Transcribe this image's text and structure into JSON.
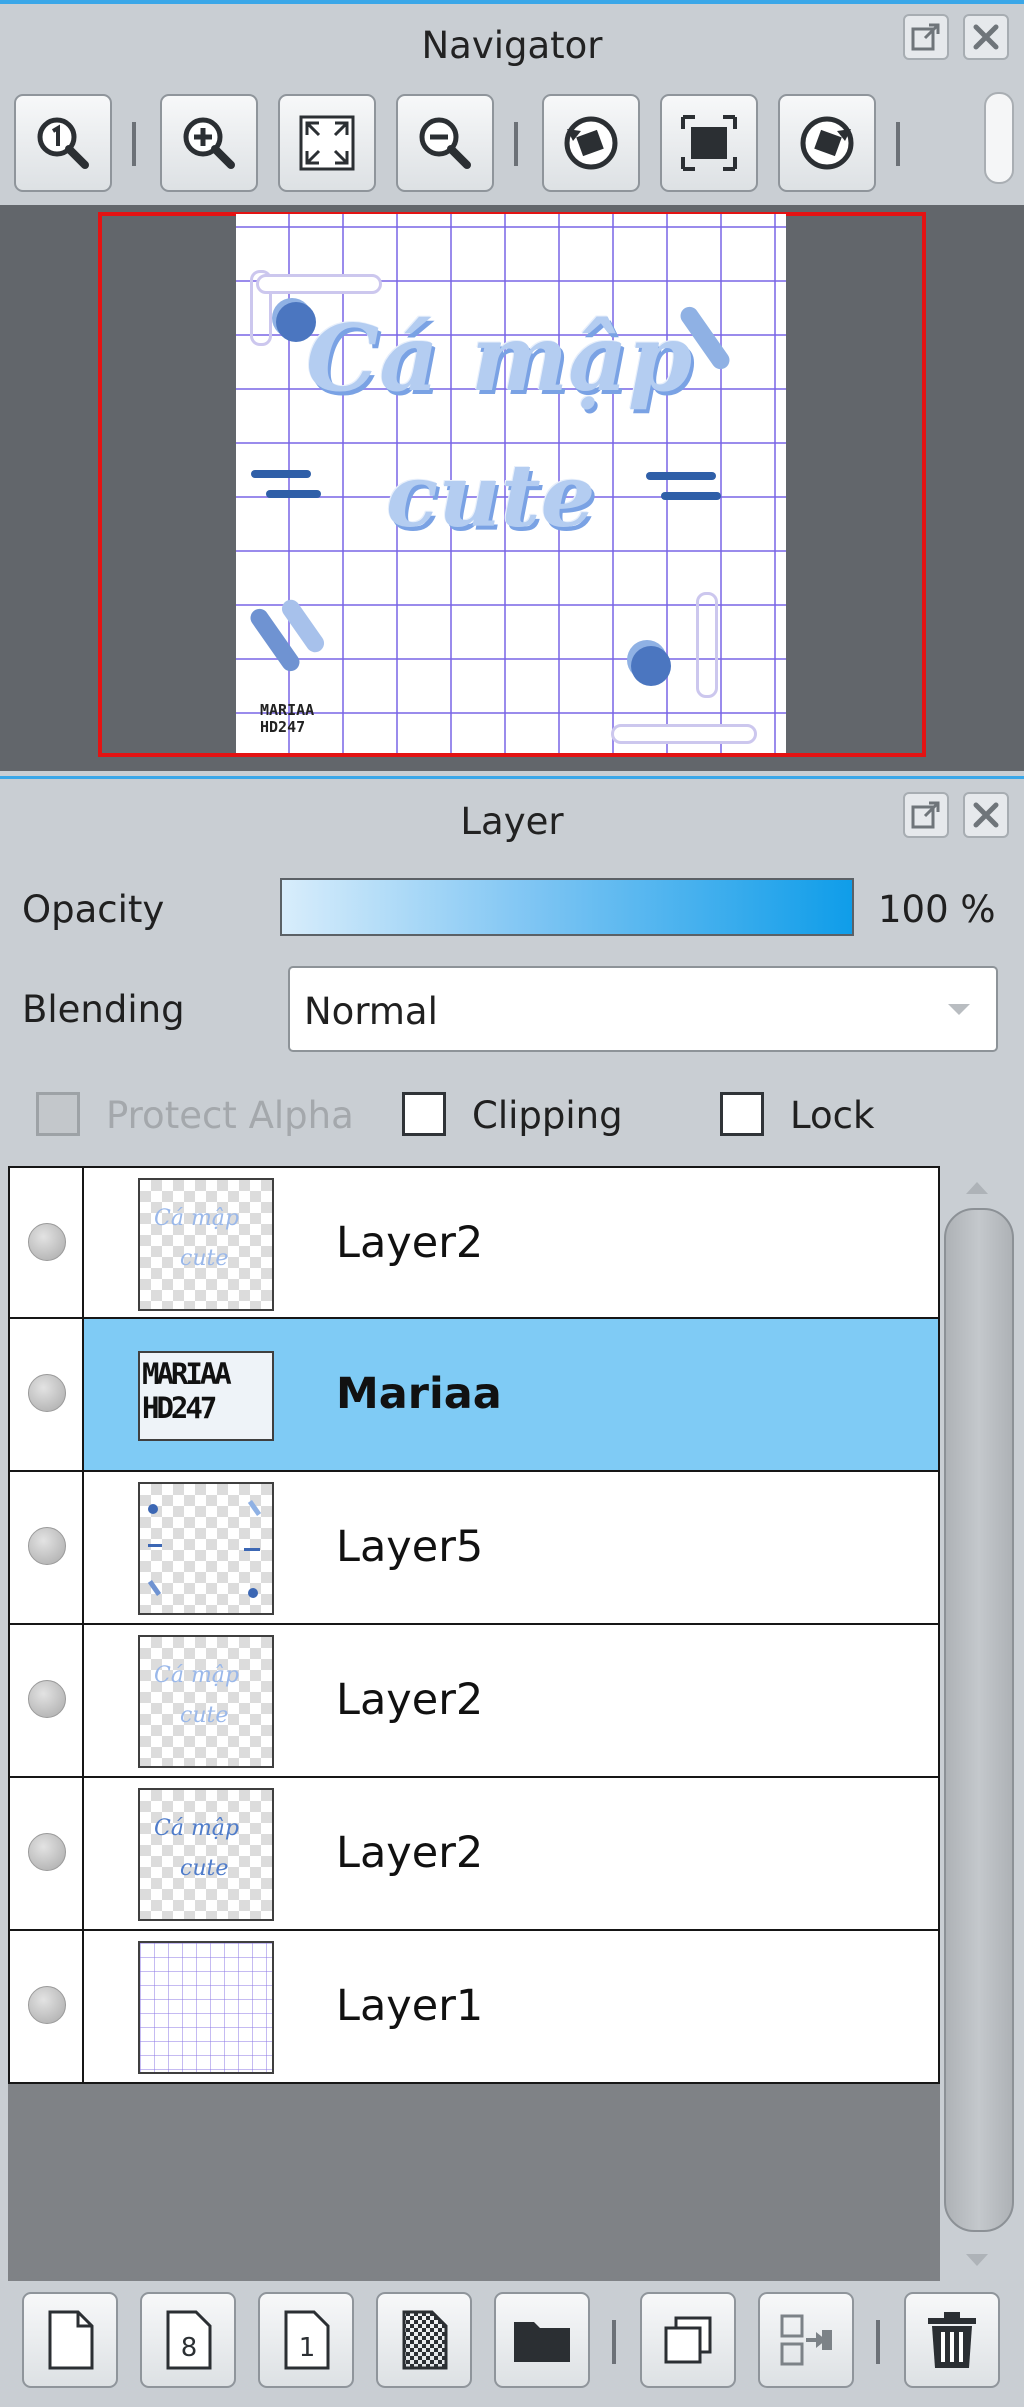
{
  "navigator": {
    "title": "Navigator",
    "toolbar": [
      "zoom-reset-icon",
      "zoom-in-icon",
      "fit-window-icon",
      "zoom-out-icon",
      "rotate-left-icon",
      "actual-size-icon",
      "rotate-right-icon"
    ],
    "canvas": {
      "title_line1": "Cá mập",
      "title_line2": "cute",
      "watermark_line1": "MARIAA",
      "watermark_line2": "HD247"
    }
  },
  "layer": {
    "title": "Layer",
    "opacity_label": "Opacity",
    "opacity_value": "100 %",
    "opacity_fraction": 1.0,
    "blending_label": "Blending",
    "blending_value": "Normal",
    "protect_alpha_label": "Protect Alpha",
    "clipping_label": "Clipping",
    "lock_label": "Lock",
    "layers": [
      {
        "name": "Layer2",
        "selected": false
      },
      {
        "name": "Mariaa",
        "selected": true
      },
      {
        "name": "Layer5",
        "selected": false
      },
      {
        "name": "Layer2",
        "selected": false
      },
      {
        "name": "Layer2",
        "selected": false
      },
      {
        "name": "Layer1",
        "selected": false
      }
    ],
    "thumbs": {
      "mariaa_line1": "MARIAA",
      "mariaa_line2": "HD247",
      "text_line1": "Cá mập",
      "text_line2": "cute"
    },
    "bottom_toolbar": [
      "new-layer-icon",
      "new-8bit-layer-icon",
      "new-1bit-layer-icon",
      "new-halftone-layer-icon",
      "new-folder-icon",
      "duplicate-layer-icon",
      "merge-down-icon",
      "delete-layer-icon"
    ]
  },
  "colors": {
    "accent": "#3aa7e8",
    "selection": "#7fcbf5",
    "preview_frame": "#e31313"
  }
}
